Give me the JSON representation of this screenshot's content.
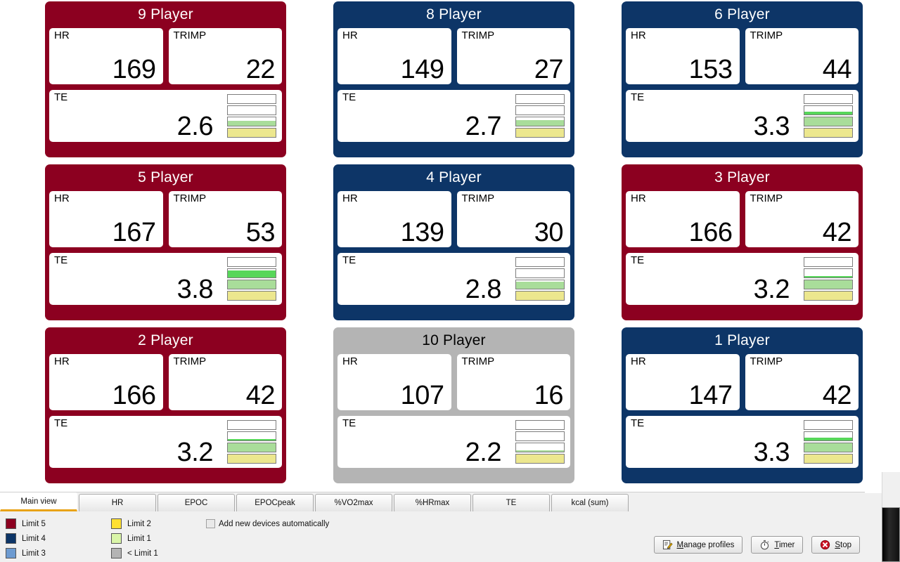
{
  "app": {
    "gauge_max_segments": 4
  },
  "cards": [
    {
      "title": "9 Player",
      "color_key": "red",
      "color": "#8c0020",
      "hr_label": "HR",
      "hr": "169",
      "trimp_label": "TRIMP",
      "trimp": "22",
      "te_label": "TE",
      "te": "2.6"
    },
    {
      "title": "8 Player",
      "color_key": "navy",
      "color": "#0d3567",
      "hr_label": "HR",
      "hr": "149",
      "trimp_label": "TRIMP",
      "trimp": "27",
      "te_label": "TE",
      "te": "2.7"
    },
    {
      "title": "6 Player",
      "color_key": "navy",
      "color": "#0d3567",
      "hr_label": "HR",
      "hr": "153",
      "trimp_label": "TRIMP",
      "trimp": "44",
      "te_label": "TE",
      "te": "3.3"
    },
    {
      "title": "5 Player",
      "color_key": "red",
      "color": "#8c0020",
      "hr_label": "HR",
      "hr": "167",
      "trimp_label": "TRIMP",
      "trimp": "53",
      "te_label": "TE",
      "te": "3.8"
    },
    {
      "title": "4 Player",
      "color_key": "navy",
      "color": "#0d3567",
      "hr_label": "HR",
      "hr": "139",
      "trimp_label": "TRIMP",
      "trimp": "30",
      "te_label": "TE",
      "te": "2.8"
    },
    {
      "title": "3 Player",
      "color_key": "red",
      "color": "#8c0020",
      "hr_label": "HR",
      "hr": "166",
      "trimp_label": "TRIMP",
      "trimp": "42",
      "te_label": "TE",
      "te": "3.2"
    },
    {
      "title": "2 Player",
      "color_key": "red",
      "color": "#8c0020",
      "hr_label": "HR",
      "hr": "166",
      "trimp_label": "TRIMP",
      "trimp": "42",
      "te_label": "TE",
      "te": "3.2"
    },
    {
      "title": "10 Player",
      "color_key": "grey",
      "color": "#b4b4b4",
      "hr_label": "HR",
      "hr": "107",
      "trimp_label": "TRIMP",
      "trimp": "16",
      "te_label": "TE",
      "te": "2.2"
    },
    {
      "title": "1 Player",
      "color_key": "navy",
      "color": "#0d3567",
      "hr_label": "HR",
      "hr": "147",
      "trimp_label": "TRIMP",
      "trimp": "42",
      "te_label": "TE",
      "te": "3.3"
    }
  ],
  "tabs": [
    {
      "label": "Main view",
      "active": true
    },
    {
      "label": "HR",
      "active": false
    },
    {
      "label": "EPOC",
      "active": false
    },
    {
      "label": "EPOCpeak",
      "active": false
    },
    {
      "label": "%VO2max",
      "active": false
    },
    {
      "label": "%HRmax",
      "active": false
    },
    {
      "label": "TE",
      "active": false
    },
    {
      "label": "kcal (sum)",
      "active": false
    }
  ],
  "legend": [
    {
      "label": "Limit 5",
      "color": "#8c0020"
    },
    {
      "label": "Limit 2",
      "color": "#ffe033"
    },
    {
      "label": "Limit 4",
      "color": "#0d3567"
    },
    {
      "label": "Limit 1",
      "color": "#d9f5a8"
    },
    {
      "label": "Limit 3",
      "color": "#6d9bd1"
    },
    {
      "label": "< Limit 1",
      "color": "#b4b4b4"
    }
  ],
  "checkbox": {
    "label": "Add new devices automatically",
    "checked": false
  },
  "buttons": [
    {
      "label_prefix": "",
      "accel": "M",
      "label_rest": "anage profiles",
      "icon": "edit-note-icon"
    },
    {
      "label_prefix": "",
      "accel": "T",
      "label_rest": "imer",
      "icon": "stopwatch-icon"
    },
    {
      "label_prefix": "",
      "accel": "S",
      "label_rest": "top",
      "icon": "stop-error-icon"
    }
  ],
  "gauge_colors": {
    "yellow": "#ece78e",
    "light_green": "#a9dd9a",
    "bright_green": "#57d65a",
    "empty": "#ffffff"
  }
}
